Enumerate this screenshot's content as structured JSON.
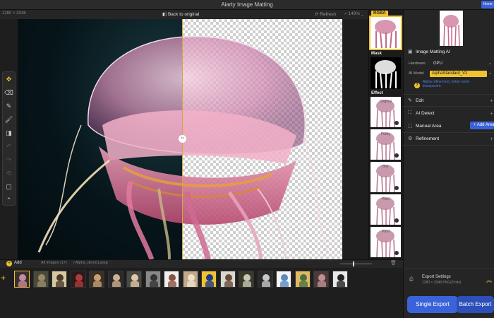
{
  "window": {
    "title": "Aiarty Image Matting",
    "home_button": "Home"
  },
  "topbar": {
    "dimensions": "1280 × 2048",
    "back_label": "Back to original",
    "refresh_label": "Refresh",
    "zoom": "149%"
  },
  "toolbar": {
    "tools": [
      {
        "name": "move-tool",
        "glyph": "✥",
        "state": "active"
      },
      {
        "name": "eraser-tool",
        "glyph": "⌫",
        "state": "normal"
      },
      {
        "name": "pencil-tool",
        "glyph": "✎",
        "state": "normal"
      },
      {
        "name": "brush-tool",
        "glyph": "🖌",
        "state": "normal"
      },
      {
        "name": "bucket-tool",
        "glyph": "◨",
        "state": "normal"
      },
      {
        "name": "undo-tool",
        "glyph": "↶",
        "state": "dim"
      },
      {
        "name": "redo-tool",
        "glyph": "↷",
        "state": "dim"
      },
      {
        "name": "reset-tool",
        "glyph": "⟲",
        "state": "dim"
      },
      {
        "name": "compare-tool",
        "glyph": "▢",
        "state": "normal"
      },
      {
        "name": "collapse-tool",
        "glyph": "⌃",
        "state": "normal"
      }
    ]
  },
  "rail": {
    "rgba_label": "RGBA",
    "mask_label": "Mask",
    "effect_label": "Effect",
    "effect_thumbs": [
      "Original",
      "Fuzzy",
      "Blur",
      "Pixel",
      "Pixel",
      "Pixel"
    ]
  },
  "panel": {
    "section_title": "Image Matting AI",
    "hardware_label": "Hardware",
    "hardware_value": "GPU",
    "model_label": "AI Model",
    "model_value": "AlphaStandard_V2",
    "model_hint": "Alpha refinement, better semi-transparent.",
    "edit_label": "Edit",
    "ai_detect_label": "AI Detect",
    "manual_area_label": "Manual Area",
    "add_area_label": "+ Add Area",
    "refinement_label": "Refinement"
  },
  "export": {
    "title": "Export Settings",
    "subtitle": "1280 × 2048 PNG(8 bits)",
    "single_label": "Single Export",
    "batch_label": "Batch Export"
  },
  "filmstrip": {
    "add_label": "Add",
    "count_label": "All images (17)",
    "current_file": "/ Alpha_demo1.jpeg",
    "thumbs": [
      {
        "name": "film-thumb-jellyfish",
        "bg": "#3a3030",
        "accent": "#c78aa0"
      },
      {
        "name": "film-thumb-deer",
        "bg": "#4a4a3a",
        "accent": "#9a8a6a"
      },
      {
        "name": "film-thumb-bicycle",
        "bg": "#d8c8a0",
        "accent": "#4a3a2a"
      },
      {
        "name": "film-thumb-woman-red",
        "bg": "#2a1a1a",
        "accent": "#b03a3a"
      },
      {
        "name": "film-thumb-hair-1",
        "bg": "#3a3028",
        "accent": "#c8a070"
      },
      {
        "name": "film-thumb-girl-1",
        "bg": "#2a2a2a",
        "accent": "#d0b090"
      },
      {
        "name": "film-thumb-lady-hat",
        "bg": "#4a4a44",
        "accent": "#e0c8a8"
      },
      {
        "name": "film-thumb-portrait-bw",
        "bg": "#888888",
        "accent": "#333333"
      },
      {
        "name": "film-thumb-smile",
        "bg": "#efefef",
        "accent": "#8a5040"
      },
      {
        "name": "film-thumb-hands",
        "bg": "#c0a888",
        "accent": "#f0e0c8"
      },
      {
        "name": "film-thumb-yellow-shirt",
        "bg": "#f0c230",
        "accent": "#1a3a8a"
      },
      {
        "name": "film-thumb-baby",
        "bg": "#d8d8d0",
        "accent": "#6a4a3a"
      },
      {
        "name": "film-thumb-car",
        "bg": "#3a3a2a",
        "accent": "#c8c8b8"
      },
      {
        "name": "film-thumb-man-back",
        "bg": "#2a2a2a",
        "accent": "#c8c8c8"
      },
      {
        "name": "film-thumb-water",
        "bg": "#f4f4f4",
        "accent": "#5a8ac0"
      },
      {
        "name": "film-thumb-woman-field",
        "bg": "#e0b860",
        "accent": "#4a7040"
      },
      {
        "name": "film-thumb-woman-dark",
        "bg": "#4a3a3a",
        "accent": "#c09090"
      },
      {
        "name": "film-thumb-bw-car",
        "bg": "#e8e8e8",
        "accent": "#222222"
      }
    ]
  }
}
